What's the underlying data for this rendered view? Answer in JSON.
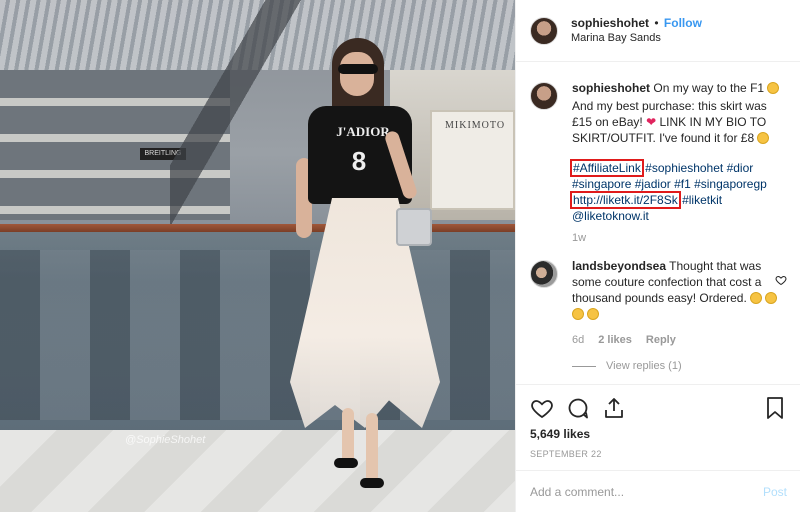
{
  "photo": {
    "watermark": "@SophieShohet",
    "shirt_text": "J'ADIOR",
    "shirt_number": "8",
    "store_sign": "MIKIMOTO",
    "store_sign2": "BREITLING"
  },
  "header": {
    "username": "sophieshohet",
    "separator": "•",
    "follow_label": "Follow",
    "location": "Marina Bay Sands"
  },
  "caption": {
    "username": "sophieshohet",
    "text_1": "On my way to the F1",
    "text_2": "And my best purchase: this skirt was £15 on eBay!",
    "text_3": "LINK IN MY BIO TO SKIRT/OUTFIT. I've found it for £8",
    "hashtag_boxed": "#AffiliateLink",
    "hashtags_1": "#sophieshohet #dior #singapore #jadior #f1 #singaporegp",
    "link_boxed": "http://liketk.it/2F8Sk",
    "hashtags_2": "#liketkit",
    "mention": "@liketoknow.it",
    "time": "1w"
  },
  "comment": {
    "username": "landsbeyondsea",
    "text": "Thought that was some couture confection that cost a thousand pounds easy! Ordered.",
    "time": "6d",
    "likes": "2 likes",
    "reply_label": "Reply",
    "view_replies": "View replies (1)"
  },
  "actions": {
    "likes": "5,649 likes",
    "date": "SEPTEMBER 22"
  },
  "add_comment": {
    "placeholder": "Add a comment...",
    "post_label": "Post"
  },
  "colors": {
    "accent": "#3897f0",
    "hashtag": "#003569",
    "annotation_box": "#e01b1b",
    "muted": "#999999",
    "post_disabled": "#b2dffc"
  },
  "icons": [
    "heart-icon",
    "comment-icon",
    "share-icon",
    "bookmark-icon",
    "emoji-icon",
    "red-heart-icon"
  ]
}
